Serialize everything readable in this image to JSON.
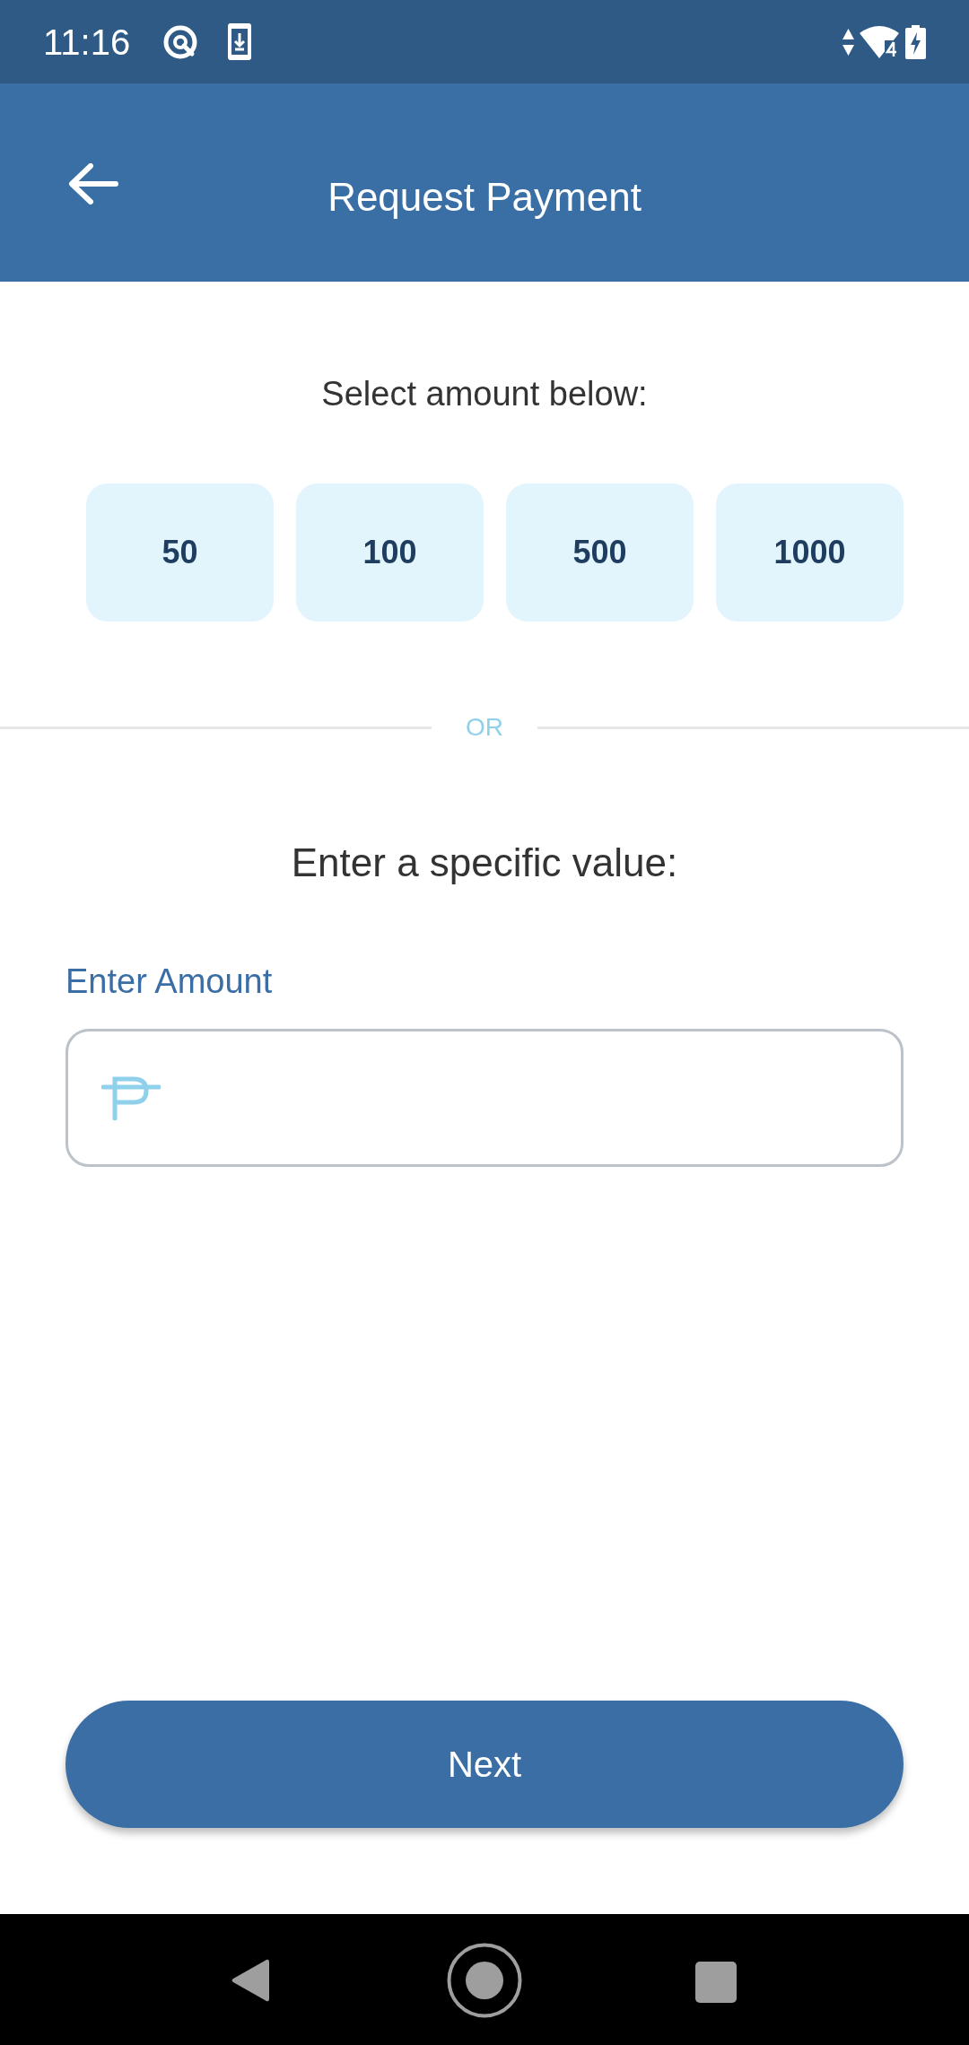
{
  "status_bar": {
    "time": "11:16"
  },
  "app_bar": {
    "title": "Request Payment"
  },
  "amount_prompt": "Select amount below:",
  "amounts": [
    {
      "label": "50",
      "selected": false
    },
    {
      "label": "100",
      "selected": false
    },
    {
      "label": "500",
      "selected": false
    },
    {
      "label": "1000",
      "selected": false
    }
  ],
  "divider_label": "OR",
  "custom_prompt": "Enter a specific value:",
  "amount_field": {
    "label": "Enter Amount"
  },
  "next_button": "Next"
}
